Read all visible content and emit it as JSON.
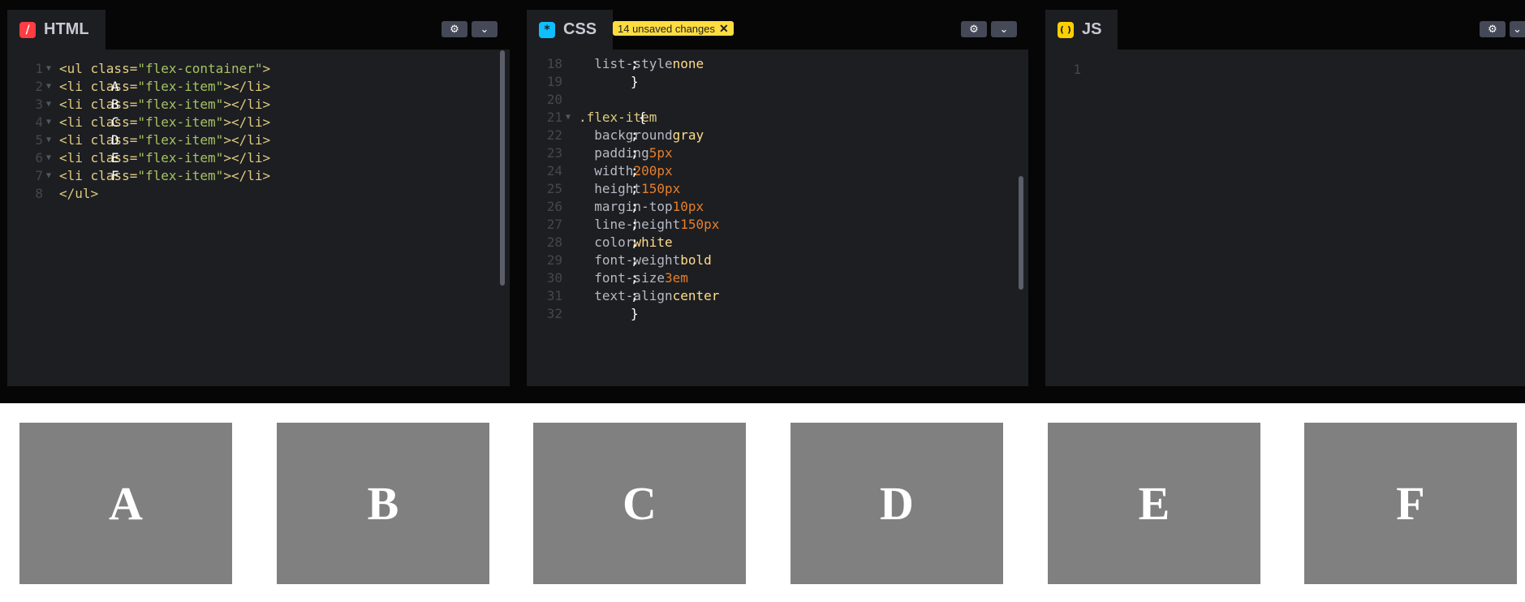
{
  "html_panel": {
    "tab_label": "HTML",
    "icon": "slash-icon",
    "icon_color": "#ff3c41",
    "lines": [
      {
        "n": "1",
        "parts": [
          [
            "tag",
            "<ul "
          ],
          [
            "attr",
            "class"
          ],
          [
            "tag",
            "="
          ],
          [
            "str",
            "\"flex-container\""
          ],
          [
            "tag",
            ">"
          ]
        ]
      },
      {
        "n": "2",
        "parts": [
          [
            "txt",
            "  "
          ],
          [
            "tag",
            "<li "
          ],
          [
            "attr",
            "class"
          ],
          [
            "tag",
            "="
          ],
          [
            "str",
            "\"flex-item\""
          ],
          [
            "tag",
            ">"
          ],
          [
            "txt",
            "A"
          ],
          [
            "tag",
            "</li>"
          ]
        ]
      },
      {
        "n": "3",
        "parts": [
          [
            "txt",
            "  "
          ],
          [
            "tag",
            "<li "
          ],
          [
            "attr",
            "class"
          ],
          [
            "tag",
            "="
          ],
          [
            "str",
            "\"flex-item\""
          ],
          [
            "tag",
            ">"
          ],
          [
            "txt",
            "B"
          ],
          [
            "tag",
            "</li>"
          ]
        ]
      },
      {
        "n": "4",
        "parts": [
          [
            "txt",
            "  "
          ],
          [
            "tag",
            "<li "
          ],
          [
            "attr",
            "class"
          ],
          [
            "tag",
            "="
          ],
          [
            "str",
            "\"flex-item\""
          ],
          [
            "tag",
            ">"
          ],
          [
            "txt",
            "C"
          ],
          [
            "tag",
            "</li>"
          ]
        ]
      },
      {
        "n": "5",
        "parts": [
          [
            "txt",
            "  "
          ],
          [
            "tag",
            "<li "
          ],
          [
            "attr",
            "class"
          ],
          [
            "tag",
            "="
          ],
          [
            "str",
            "\"flex-item\""
          ],
          [
            "tag",
            ">"
          ],
          [
            "txt",
            "D"
          ],
          [
            "tag",
            "</li>"
          ]
        ]
      },
      {
        "n": "6",
        "parts": [
          [
            "txt",
            "  "
          ],
          [
            "tag",
            "<li "
          ],
          [
            "attr",
            "class"
          ],
          [
            "tag",
            "="
          ],
          [
            "str",
            "\"flex-item\""
          ],
          [
            "tag",
            ">"
          ],
          [
            "txt",
            "E"
          ],
          [
            "tag",
            "</li>"
          ]
        ]
      },
      {
        "n": "7",
        "parts": [
          [
            "txt",
            "  "
          ],
          [
            "tag",
            "<li "
          ],
          [
            "attr",
            "class"
          ],
          [
            "tag",
            "="
          ],
          [
            "str",
            "\"flex-item\""
          ],
          [
            "tag",
            ">"
          ],
          [
            "txt",
            "F"
          ],
          [
            "tag",
            "</li>"
          ]
        ]
      },
      {
        "n": "8",
        "parts": [
          [
            "tag",
            "</ul>"
          ]
        ]
      }
    ]
  },
  "css_panel": {
    "tab_label": "CSS",
    "icon": "asterisk-icon",
    "icon_color": "#0ebeff",
    "unsaved_badge": "14 unsaved changes",
    "lines": [
      {
        "n": "18",
        "parts": [
          [
            "prop",
            "  list-style"
          ],
          [
            "txt",
            ": "
          ],
          [
            "val",
            "none"
          ],
          [
            "txt",
            ";"
          ]
        ]
      },
      {
        "n": "19",
        "parts": [
          [
            "txt",
            "}"
          ]
        ]
      },
      {
        "n": "20",
        "parts": []
      },
      {
        "n": "21",
        "parts": [
          [
            "sel",
            ".flex-item"
          ],
          [
            "txt",
            " {"
          ]
        ]
      },
      {
        "n": "22",
        "parts": [
          [
            "prop",
            "  background"
          ],
          [
            "txt",
            ": "
          ],
          [
            "val",
            "gray"
          ],
          [
            "txt",
            ";"
          ]
        ]
      },
      {
        "n": "23",
        "parts": [
          [
            "prop",
            "  padding"
          ],
          [
            "txt",
            ": "
          ],
          [
            "num",
            "5px"
          ],
          [
            "txt",
            ";"
          ]
        ]
      },
      {
        "n": "24",
        "parts": [
          [
            "prop",
            "  width"
          ],
          [
            "txt",
            ": "
          ],
          [
            "num",
            "200px"
          ],
          [
            "txt",
            ";"
          ]
        ]
      },
      {
        "n": "25",
        "parts": [
          [
            "prop",
            "  height"
          ],
          [
            "txt",
            ": "
          ],
          [
            "num",
            "150px"
          ],
          [
            "txt",
            ";"
          ]
        ]
      },
      {
        "n": "26",
        "parts": [
          [
            "prop",
            "  margin-top"
          ],
          [
            "txt",
            ": "
          ],
          [
            "num",
            "10px"
          ],
          [
            "txt",
            ";"
          ]
        ]
      },
      {
        "n": "27",
        "parts": [
          [
            "prop",
            "  line-height"
          ],
          [
            "txt",
            ": "
          ],
          [
            "num",
            "150px"
          ],
          [
            "txt",
            ";"
          ]
        ]
      },
      {
        "n": "28",
        "parts": [
          [
            "prop",
            "  color"
          ],
          [
            "txt",
            ": "
          ],
          [
            "val",
            "white"
          ],
          [
            "txt",
            ";"
          ]
        ]
      },
      {
        "n": "29",
        "parts": [
          [
            "prop",
            "  font-weight"
          ],
          [
            "txt",
            ": "
          ],
          [
            "val",
            "bold"
          ],
          [
            "txt",
            ";"
          ]
        ]
      },
      {
        "n": "30",
        "parts": [
          [
            "prop",
            "  font-size"
          ],
          [
            "txt",
            ": "
          ],
          [
            "num",
            "3em"
          ],
          [
            "txt",
            ";"
          ]
        ]
      },
      {
        "n": "31",
        "parts": [
          [
            "prop",
            "  text-align"
          ],
          [
            "txt",
            ": "
          ],
          [
            "val",
            "center"
          ],
          [
            "txt",
            ";"
          ]
        ]
      },
      {
        "n": "32",
        "parts": [
          [
            "txt",
            "}"
          ]
        ]
      }
    ]
  },
  "js_panel": {
    "tab_label": "JS",
    "icon": "braces-icon",
    "icon_color": "#fcd000",
    "lines": [
      {
        "n": "1",
        "parts": []
      }
    ]
  },
  "preview": {
    "items": [
      "A",
      "B",
      "C",
      "D",
      "E",
      "F"
    ]
  },
  "header_buttons": {
    "settings_icon": "gear-icon",
    "menu_icon": "chevron-down-icon"
  }
}
